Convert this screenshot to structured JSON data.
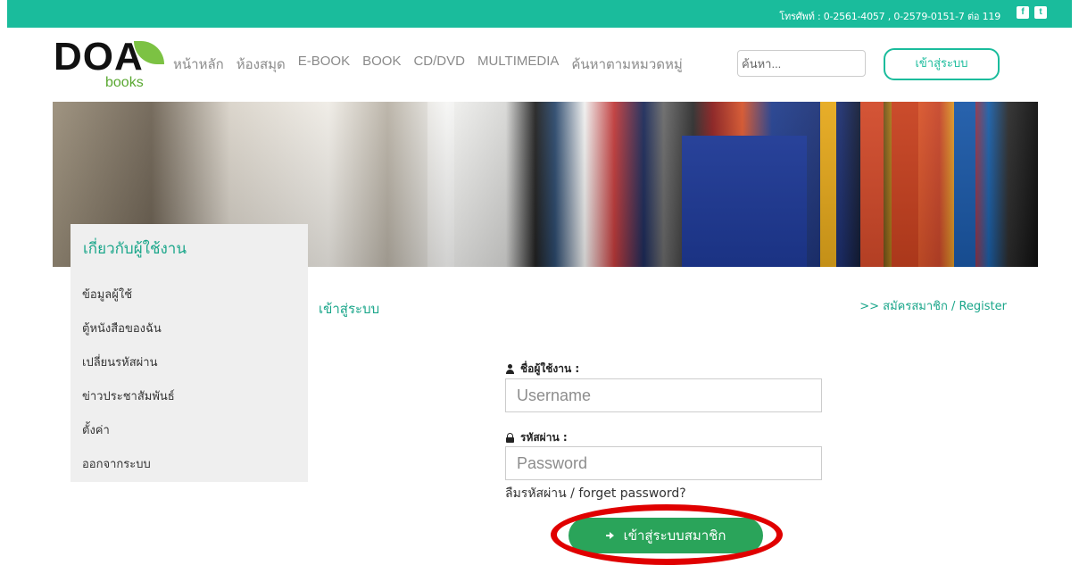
{
  "topbar": {
    "phone": "โทรศัพท์ : 0-2561-4057 , 0-2579-0151-7 ต่อ 119",
    "facebook_icon": "facebook-icon",
    "twitter_icon": "twitter-icon",
    "facebook_glyph": "f",
    "twitter_glyph": "t"
  },
  "logo": {
    "mark": "DOA",
    "sub": "books"
  },
  "nav": {
    "items": [
      "หน้าหลัก",
      "ห้องสมุด",
      "E-BOOK",
      "BOOK",
      "CD/DVD",
      "MULTIMEDIA",
      "ค้นหาตามหมวดหมู่"
    ]
  },
  "search": {
    "placeholder": "ค้นหา..."
  },
  "header": {
    "login_label": "เข้าสู่ระบบ"
  },
  "sidebar": {
    "title": "เกี่ยวกับผู้ใช้งาน",
    "items": [
      {
        "label": "ข้อมูลผู้ใช้"
      },
      {
        "label": "ตู้หนังสือของฉัน"
      },
      {
        "label": "เปลี่ยนรหัสผ่าน"
      },
      {
        "label": "ข่าวประชาสัมพันธ์"
      },
      {
        "label": "ตั้งค่า"
      },
      {
        "label": "ออกจากระบบ"
      }
    ]
  },
  "main": {
    "heading": "เข้าสู่ระบบ",
    "register": ">> สมัครสมาชิก / Register",
    "username_label": "ชื่อผู้ใช้งาน :",
    "username_placeholder": "Username",
    "password_label": "รหัสผ่าน :",
    "password_placeholder": "Password",
    "forgot": "ลืมรหัสผ่าน / forget password?",
    "submit_label": "เข้าสู่ระบบสมาชิก"
  },
  "colors": {
    "accent": "#1abc9c",
    "button": "#2aa45a",
    "highlight_ring": "#e00000"
  }
}
